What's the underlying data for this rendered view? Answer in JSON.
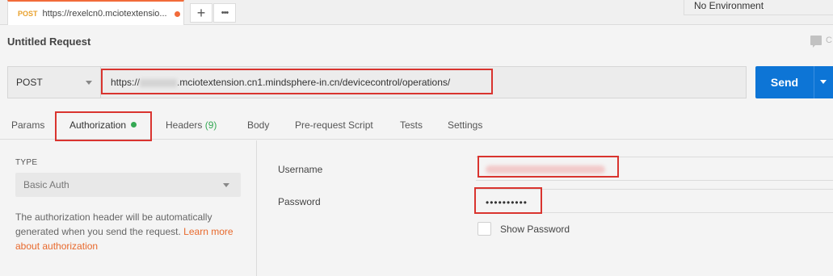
{
  "tab": {
    "method": "POST",
    "title": "https://rexelcn0.mciotextensio..."
  },
  "tab_actions": {
    "new_tab": "+",
    "more": "•••"
  },
  "environment": {
    "selected": "No Environment"
  },
  "request": {
    "name": "Untitled Request",
    "comments_label": "C"
  },
  "url_bar": {
    "method": "POST",
    "url_prefix": "https://",
    "url_suffix": ".mciotextension.cn1.mindsphere-in.cn/devicecontrol/operations/",
    "send_label": "Send"
  },
  "subtabs": [
    {
      "label": "Params"
    },
    {
      "label": "Authorization"
    },
    {
      "label": "Headers",
      "count": "(9)"
    },
    {
      "label": "Body"
    },
    {
      "label": "Pre-request Script"
    },
    {
      "label": "Tests"
    },
    {
      "label": "Settings"
    }
  ],
  "auth": {
    "type_label": "TYPE",
    "type_value": "Basic Auth",
    "help_text": "The authorization header will be automatically generated when you send the request.",
    "help_link": "Learn more about authorization",
    "username_label": "Username",
    "password_label": "Password",
    "password_value": "••••••••••",
    "show_password_label": "Show Password"
  },
  "colors": {
    "accent_orange": "#f26b3a",
    "send_blue": "#0d75d6",
    "status_green": "#34a853",
    "annotation_red": "#d9342f"
  }
}
